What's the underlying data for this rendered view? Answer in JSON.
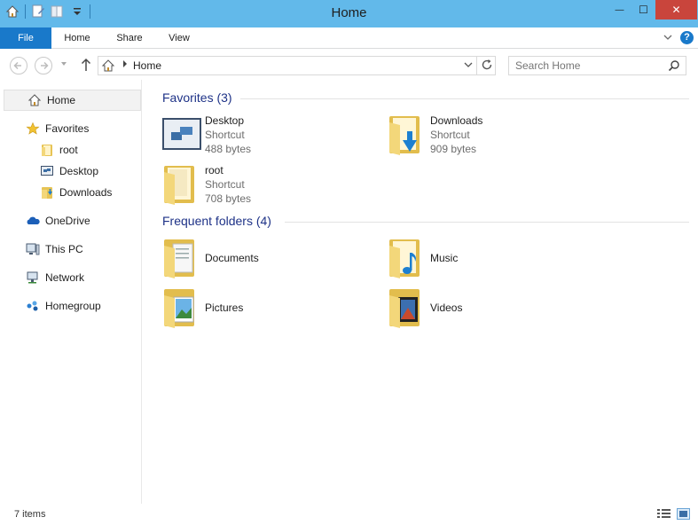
{
  "window": {
    "title": "Home",
    "minimize_glyph": "—",
    "maximize_glyph": "☐",
    "close_glyph": "✕"
  },
  "ribbon": {
    "tabs": [
      {
        "label": "File"
      },
      {
        "label": "Home"
      },
      {
        "label": "Share"
      },
      {
        "label": "View"
      }
    ],
    "help_glyph": "?"
  },
  "address": {
    "path": "Home",
    "search_placeholder": "Search Home"
  },
  "nav": {
    "home": "Home",
    "favorites": "Favorites",
    "favorites_items": [
      "root",
      "Desktop",
      "Downloads"
    ],
    "onedrive": "OneDrive",
    "this_pc": "This PC",
    "network": "Network",
    "homegroup": "Homegroup"
  },
  "groups": {
    "favorites": {
      "header": "Favorites (3)",
      "items": [
        {
          "name": "Desktop",
          "type": "Shortcut",
          "size": "488 bytes"
        },
        {
          "name": "Downloads",
          "type": "Shortcut",
          "size": "909 bytes"
        },
        {
          "name": "root",
          "type": "Shortcut",
          "size": "708 bytes"
        }
      ]
    },
    "frequent": {
      "header": "Frequent folders (4)",
      "items": [
        {
          "name": "Documents"
        },
        {
          "name": "Music"
        },
        {
          "name": "Pictures"
        },
        {
          "name": "Videos"
        }
      ]
    }
  },
  "status": {
    "count": "7 items"
  },
  "colors": {
    "titlebar": "#62b9ea",
    "file_tab": "#1979ca",
    "close_button": "#c9453c",
    "group_header": "#1e3287",
    "folder_yellow": "#f3d77a"
  }
}
